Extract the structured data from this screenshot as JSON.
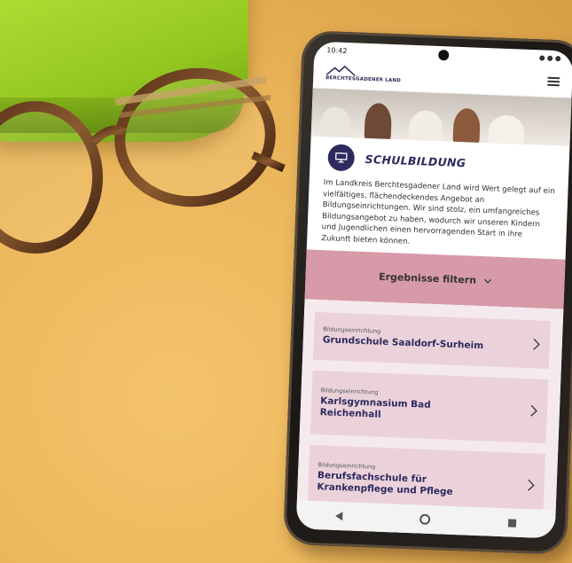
{
  "status": {
    "time": "10:42"
  },
  "header": {
    "logo_text": "BERCHTESGADENER LAND"
  },
  "section": {
    "title": "SCHULBILDUNG",
    "intro": "Im Landkreis Berchtesgadener Land wird Wert gelegt auf ein vielfältiges, flächendeckendes Angebot an Bildungseinrichtungen. Wir sind stolz, ein umfangreiches Bildungsangebot zu haben, wodurch wir unseren Kindern und Jugendlichen einen hervorragenden Start in ihre Zukunft bieten können."
  },
  "filter": {
    "label": "Ergebnisse filtern"
  },
  "items": [
    {
      "category": "Bildungseinrichtung",
      "title": "Grundschule Saaldorf-Surheim"
    },
    {
      "category": "Bildungseinrichtung",
      "title": "Karlsgymnasium Bad Reichenhall"
    },
    {
      "category": "Bildungseinrichtung",
      "title": "Berufsfachschule für Krankenpflege und Pflege"
    }
  ],
  "colors": {
    "brand": "#2c2a5e",
    "filter_bg": "#d79aa8",
    "card_bg": "#ebd2da"
  }
}
